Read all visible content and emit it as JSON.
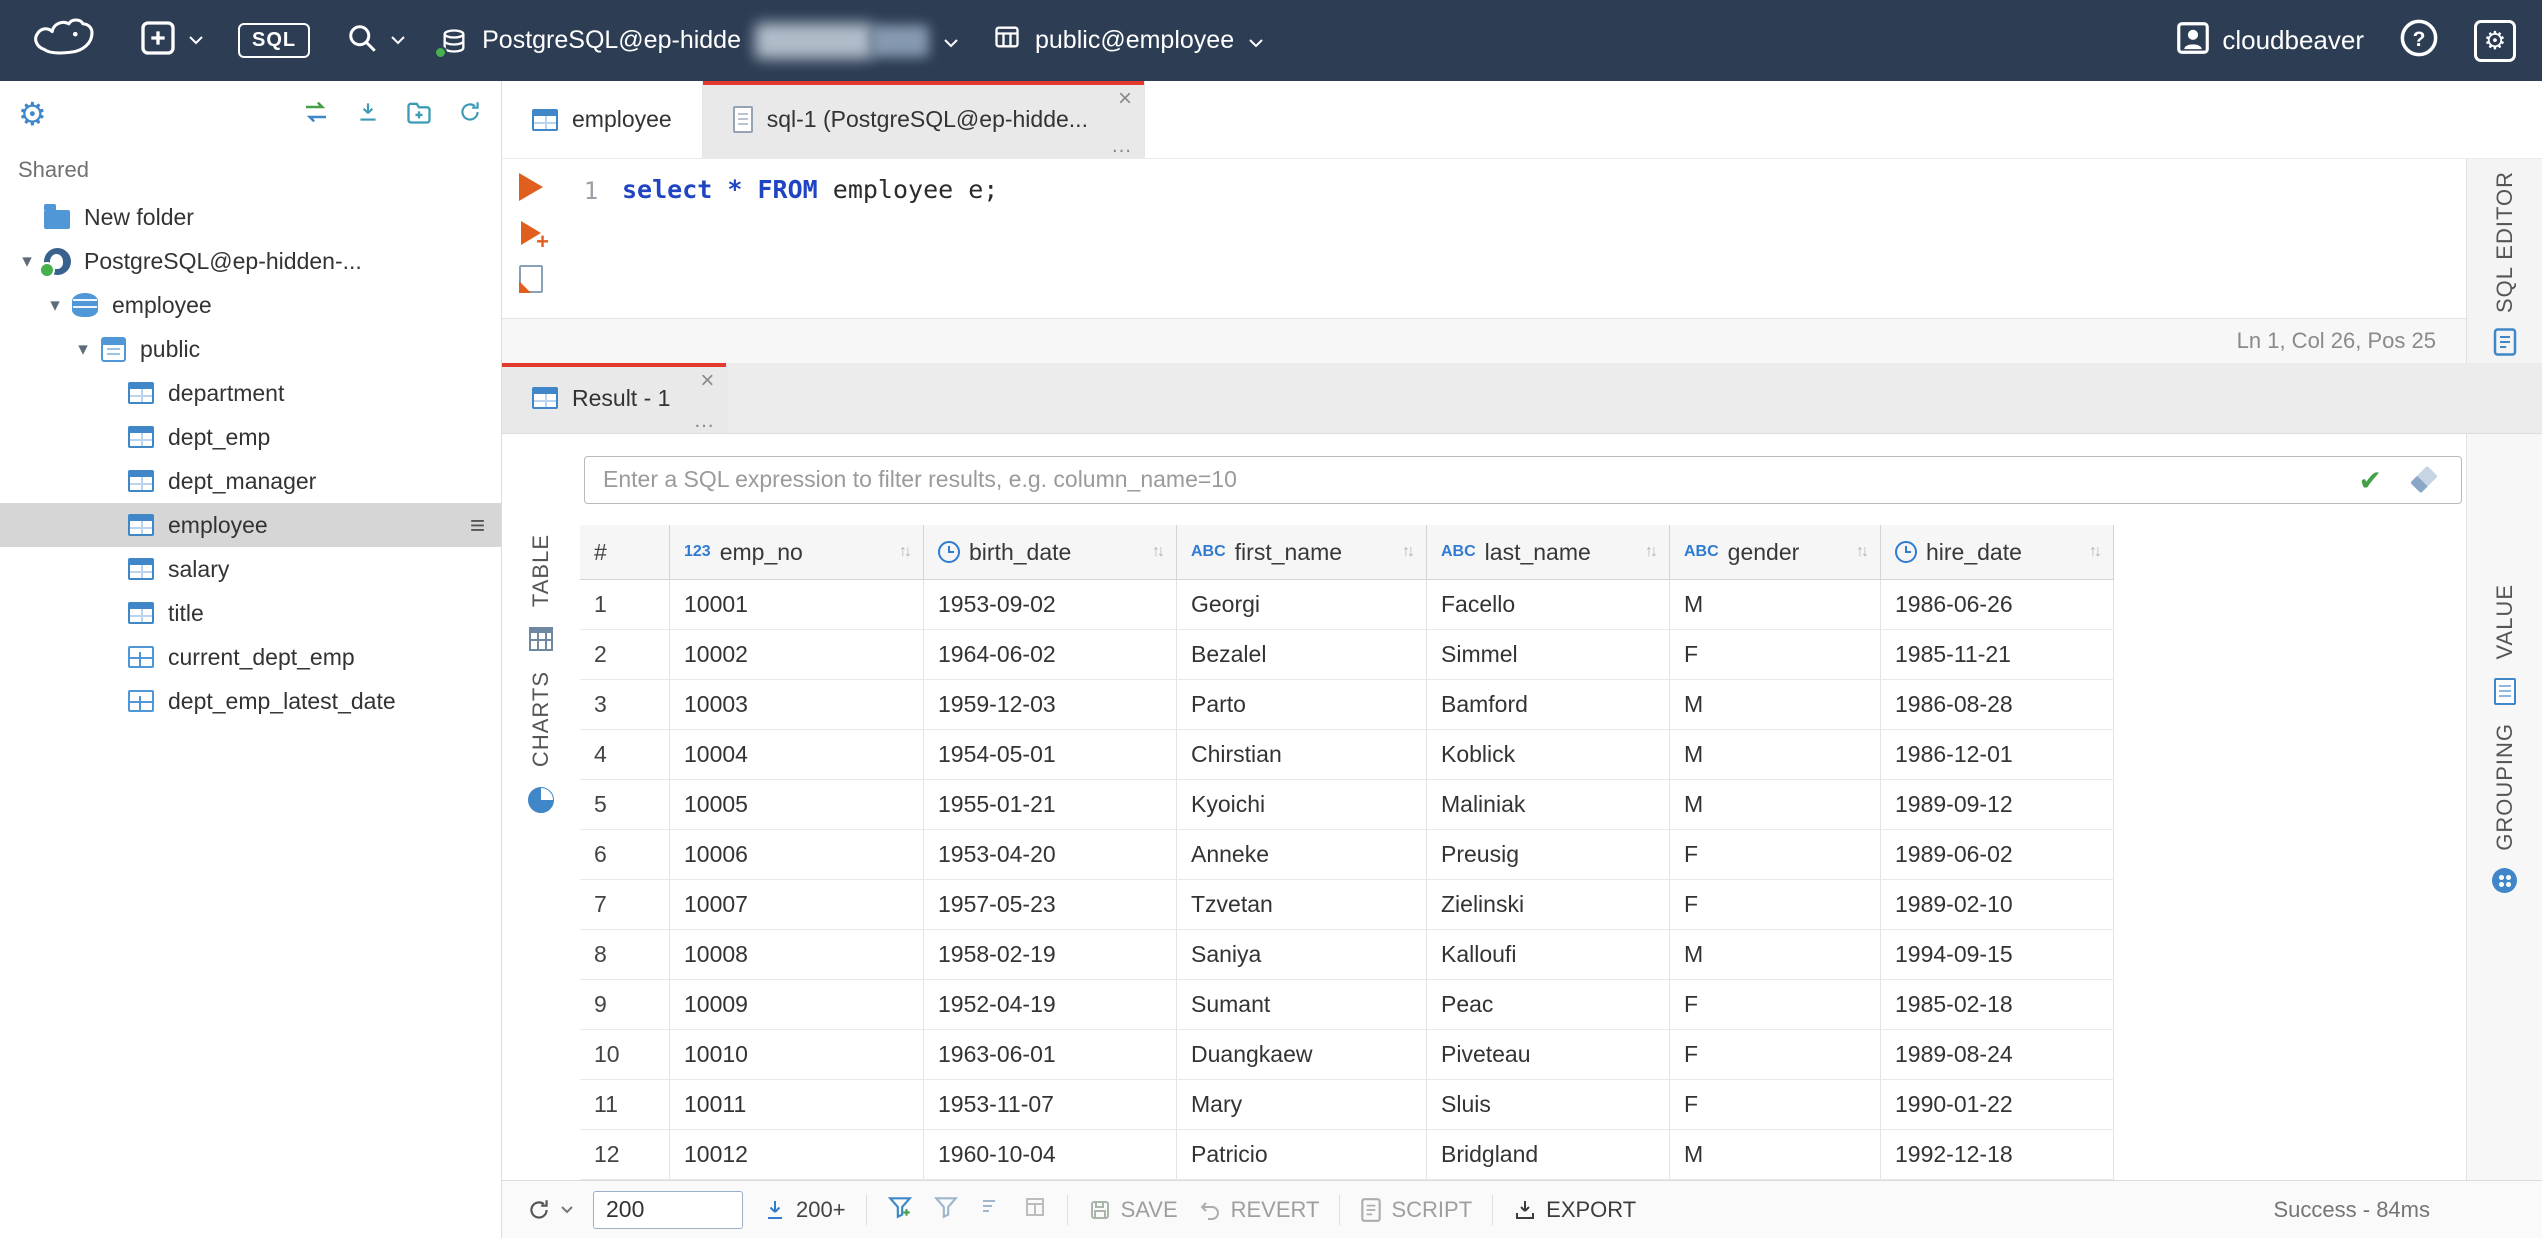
{
  "topbar": {
    "brand": "cloudbeaver",
    "sql_badge": "SQL",
    "connection": "PostgreSQL@ep-hidde",
    "schema": "public@employee"
  },
  "sidebar": {
    "section": "Shared",
    "items": [
      {
        "label": "New folder",
        "icon": "folder",
        "depth": 0,
        "chevron": false
      },
      {
        "label": "PostgreSQL@ep-hidden-...",
        "icon": "postgres",
        "depth": 0,
        "chevron": true
      },
      {
        "label": "employee",
        "icon": "database",
        "depth": 1,
        "chevron": true
      },
      {
        "label": "public",
        "icon": "schema",
        "depth": 2,
        "chevron": true
      },
      {
        "label": "department",
        "icon": "table",
        "depth": 3,
        "chevron": false
      },
      {
        "label": "dept_emp",
        "icon": "table",
        "depth": 3,
        "chevron": false
      },
      {
        "label": "dept_manager",
        "icon": "table",
        "depth": 3,
        "chevron": false
      },
      {
        "label": "employee",
        "icon": "table",
        "depth": 3,
        "chevron": false,
        "selected": true
      },
      {
        "label": "salary",
        "icon": "table",
        "depth": 3,
        "chevron": false
      },
      {
        "label": "title",
        "icon": "table",
        "depth": 3,
        "chevron": false
      },
      {
        "label": "current_dept_emp",
        "icon": "view",
        "depth": 3,
        "chevron": false
      },
      {
        "label": "dept_emp_latest_date",
        "icon": "view",
        "depth": 3,
        "chevron": false
      }
    ]
  },
  "editor": {
    "tabs": [
      {
        "label": "employee"
      },
      {
        "label": "sql-1 (PostgreSQL@ep-hidde..."
      }
    ],
    "line_number": "1",
    "code": [
      {
        "text": "select",
        "kind": "kw"
      },
      {
        "text": " ",
        "kind": "pl"
      },
      {
        "text": "*",
        "kind": "kw"
      },
      {
        "text": " ",
        "kind": "pl"
      },
      {
        "text": "FROM",
        "kind": "kw"
      },
      {
        "text": " employee e;",
        "kind": "pl"
      }
    ],
    "status": "Ln 1, Col 26, Pos 25",
    "side_tab": "SQL EDITOR"
  },
  "result": {
    "tab": "Result - 1",
    "filter_placeholder": "Enter a SQL expression to filter results, e.g. column_name=10",
    "left_tabs": [
      "TABLE",
      "CHARTS"
    ],
    "right_tabs": [
      "VALUE",
      "GROUPING"
    ],
    "grid": {
      "corner": "#",
      "columns": [
        {
          "name": "emp_no",
          "type": "123"
        },
        {
          "name": "birth_date",
          "type": "date"
        },
        {
          "name": "first_name",
          "type": "abc"
        },
        {
          "name": "last_name",
          "type": "abc"
        },
        {
          "name": "gender",
          "type": "abc"
        },
        {
          "name": "hire_date",
          "type": "date"
        }
      ],
      "rows": [
        [
          "1",
          "10001",
          "1953-09-02",
          "Georgi",
          "Facello",
          "M",
          "1986-06-26"
        ],
        [
          "2",
          "10002",
          "1964-06-02",
          "Bezalel",
          "Simmel",
          "F",
          "1985-11-21"
        ],
        [
          "3",
          "10003",
          "1959-12-03",
          "Parto",
          "Bamford",
          "M",
          "1986-08-28"
        ],
        [
          "4",
          "10004",
          "1954-05-01",
          "Chirstian",
          "Koblick",
          "M",
          "1986-12-01"
        ],
        [
          "5",
          "10005",
          "1955-01-21",
          "Kyoichi",
          "Maliniak",
          "M",
          "1989-09-12"
        ],
        [
          "6",
          "10006",
          "1953-04-20",
          "Anneke",
          "Preusig",
          "F",
          "1989-06-02"
        ],
        [
          "7",
          "10007",
          "1957-05-23",
          "Tzvetan",
          "Zielinski",
          "F",
          "1989-02-10"
        ],
        [
          "8",
          "10008",
          "1958-02-19",
          "Saniya",
          "Kalloufi",
          "M",
          "1994-09-15"
        ],
        [
          "9",
          "10009",
          "1952-04-19",
          "Sumant",
          "Peac",
          "F",
          "1985-02-18"
        ],
        [
          "10",
          "10010",
          "1963-06-01",
          "Duangkaew",
          "Piveteau",
          "F",
          "1989-08-24"
        ],
        [
          "11",
          "10011",
          "1953-11-07",
          "Mary",
          "Sluis",
          "F",
          "1990-01-22"
        ],
        [
          "12",
          "10012",
          "1960-10-04",
          "Patricio",
          "Bridgland",
          "M",
          "1992-12-18"
        ]
      ]
    }
  },
  "toolbar": {
    "row_limit": "200",
    "fetch_label": "200+",
    "save": "SAVE",
    "revert": "REVERT",
    "script": "SCRIPT",
    "export": "EXPORT",
    "status": "Success - 84ms"
  }
}
